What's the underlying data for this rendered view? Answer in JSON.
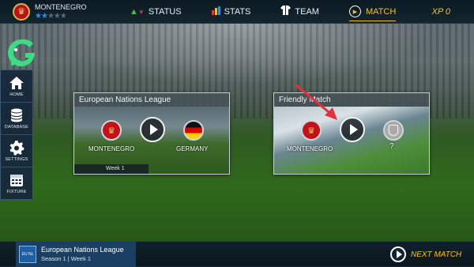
{
  "team": {
    "name": "MONTENEGRO",
    "stars_total": 5,
    "stars_filled": 2
  },
  "nav": {
    "status": "STATUS",
    "stats": "STATS",
    "team": "TEAM",
    "match": "MATCH"
  },
  "xp": "XP 0",
  "sidebar": {
    "items": [
      {
        "label": "HOME",
        "icon": "home-icon"
      },
      {
        "label": "DATABASE",
        "icon": "database-icon"
      },
      {
        "label": "SETTINGS",
        "icon": "gear-icon"
      },
      {
        "label": "FIXTURE",
        "icon": "calendar-icon"
      }
    ]
  },
  "cards": {
    "league": {
      "title": "European Nations League",
      "home": "MONTENEGRO",
      "away": "GERMANY",
      "week": "Week 1"
    },
    "friendly": {
      "title": "Friendly Match",
      "home": "MONTENEGRO",
      "away": "?"
    }
  },
  "bottom": {
    "league_name": "European Nations League",
    "league_sub": "Season 1  |  Week 1",
    "league_logo_text": "EU NL",
    "next_match": "NEXT MATCH"
  },
  "colors": {
    "accent": "#f2c12e",
    "sidebar": "#16263c",
    "arrow": "#e0323a"
  }
}
